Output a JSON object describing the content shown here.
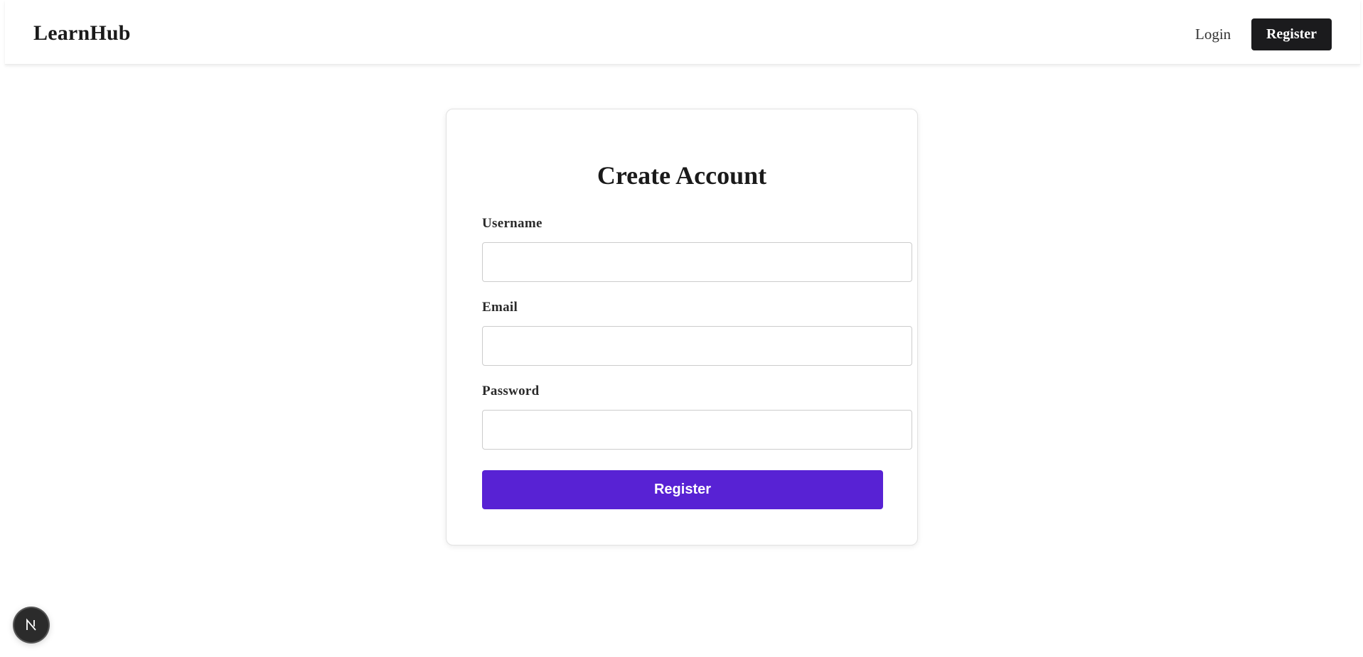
{
  "navbar": {
    "brand": "LearnHub",
    "login_label": "Login",
    "register_label": "Register"
  },
  "form": {
    "title": "Create Account",
    "fields": [
      {
        "label": "Username",
        "value": "",
        "placeholder": ""
      },
      {
        "label": "Email",
        "value": "",
        "placeholder": ""
      },
      {
        "label": "Password",
        "value": "",
        "placeholder": ""
      }
    ],
    "submit_label": "Register"
  },
  "badge": {
    "icon": "nextjs-logo-icon"
  },
  "colors": {
    "accent": "#5822d4",
    "nav_button": "#1b1b1d"
  }
}
